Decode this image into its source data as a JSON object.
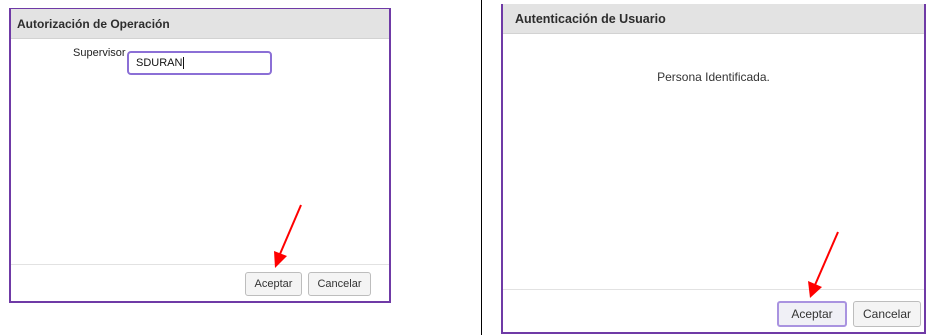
{
  "auth_dialog": {
    "title": "Autorización de Operación",
    "supervisor_label": "Supervisor",
    "supervisor_value": "SDURAN",
    "accept_label": "Aceptar",
    "cancel_label": "Cancelar"
  },
  "user_dialog": {
    "title": "Autenticación de Usuario",
    "message": "Persona Identificada.",
    "accept_label": "Aceptar",
    "cancel_label": "Cancelar"
  },
  "colors": {
    "dialog_border": "#6f3aa6",
    "header_bg": "#e3e3e3",
    "arrow": "#ff0000",
    "input_focus": "#8b6fd6"
  }
}
